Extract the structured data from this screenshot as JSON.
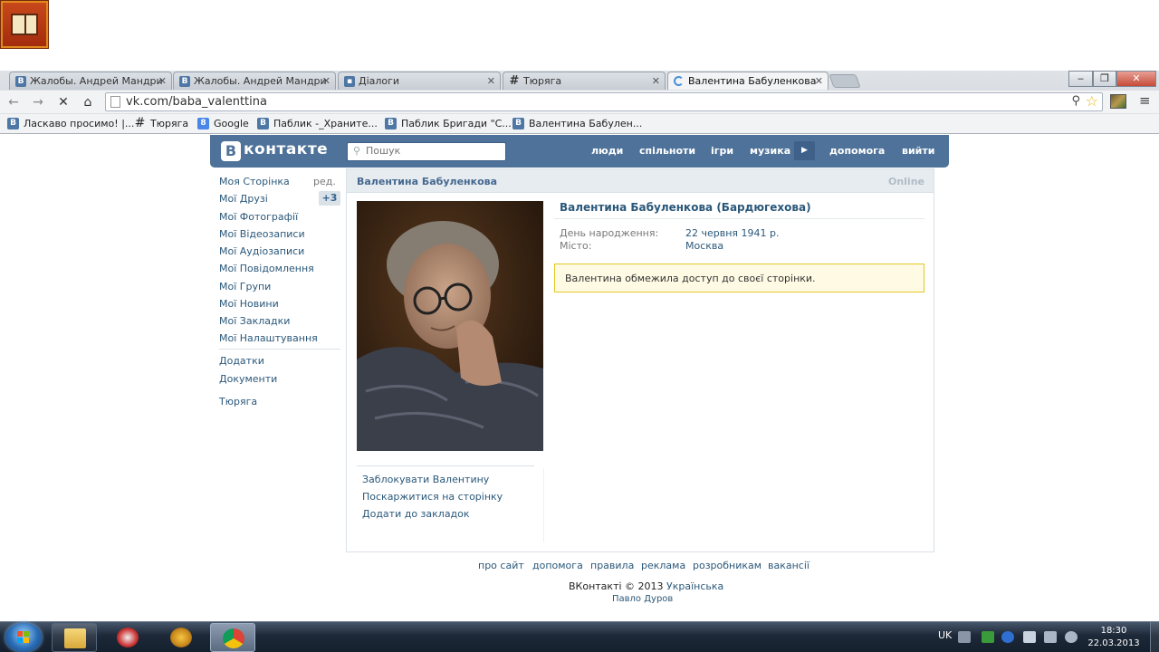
{
  "browser": {
    "tabs": [
      {
        "label": "Жалобы. Андрей Мандри"
      },
      {
        "label": "Жалобы. Андрей Мандри"
      },
      {
        "label": "Діалоги"
      },
      {
        "label": "Тюряга"
      },
      {
        "label": "Валентина Бабуленкова"
      }
    ],
    "url": "vk.com/baba_valenttina",
    "window_controls": {
      "minimize": "‒",
      "maximize": "❐",
      "close": "✕"
    },
    "bookmarks": [
      {
        "label": "Ласкаво просимо! |..."
      },
      {
        "label": "Тюряга"
      },
      {
        "label": "Google"
      },
      {
        "label": "Паблик -_Храните..."
      },
      {
        "label": "Паблик Бригади \"С..."
      },
      {
        "label": "Валентина Бабулен..."
      }
    ]
  },
  "vk_header": {
    "logo_letter": "В",
    "logo_text": "контакте",
    "search_placeholder": "Пошук",
    "nav": {
      "people": "люди",
      "communities": "спільноти",
      "games": "ігри",
      "music": "музика",
      "help": "допомога",
      "logout": "вийти"
    }
  },
  "left_menu": {
    "items": [
      "Моя Сторінка",
      "Мої Друзі",
      "Мої Фотографії",
      "Мої Відеозаписи",
      "Мої Аудіозаписи",
      "Мої Повідомлення",
      "Мої Групи",
      "Мої Новини",
      "Мої Закладки",
      "Мої Налаштування"
    ],
    "edit_label": "ред.",
    "friends_badge": "+3",
    "extra_items": [
      "Додатки",
      "Документи"
    ],
    "app_item": "Тюряга"
  },
  "profile": {
    "header_name": "Валентина Бабуленкова",
    "status": "Online",
    "full_name": "Валентина Бабуленкова (Бардюгехова)",
    "birthday_label": "День народження:",
    "birthday_value": "22 червня 1941 р.",
    "city_label": "Місто:",
    "city_value": "Москва",
    "notice": "Валентина обмежила доступ до своєї сторінки.",
    "actions": [
      "Заблокувати Валентину",
      "Поскаржитися на сторінку",
      "Додати до закладок"
    ]
  },
  "footer": {
    "links": [
      "про сайт",
      "допомога",
      "правила",
      "реклама",
      "розробникам",
      "вакансії"
    ],
    "copyright": "ВКонтакті © 2013",
    "language": "Українська",
    "author": "Павло Дуров"
  },
  "taskbar": {
    "lang": "UK",
    "time": "18:30",
    "date": "22.03.2013"
  },
  "colors": {
    "vk_header": "#4e7299",
    "link": "#2b587a",
    "notice_bg": "#fefae4",
    "notice_border": "#e2c822"
  }
}
